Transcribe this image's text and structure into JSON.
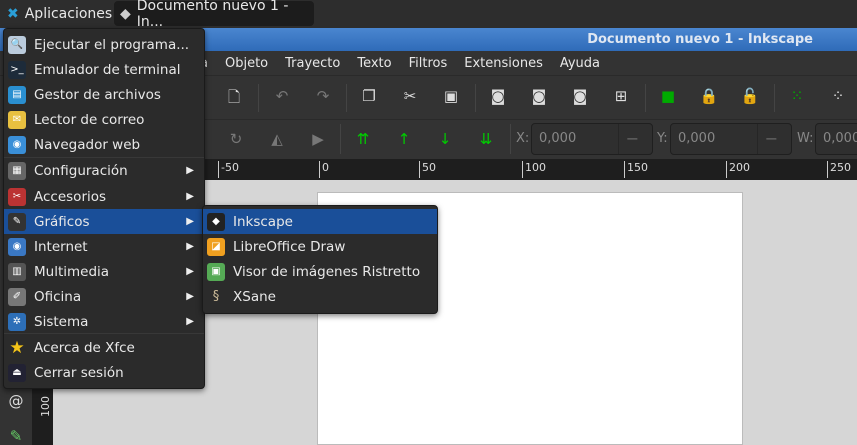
{
  "panel": {
    "apps_label": "Aplicaciones",
    "task_label": "Documento nuevo 1 - In..."
  },
  "window": {
    "title": "Documento nuevo 1 - Inkscape"
  },
  "menubar": [
    "a",
    "Objeto",
    "Trayecto",
    "Texto",
    "Filtros",
    "Extensiones",
    "Ayuda"
  ],
  "toolbar": {
    "x_label": "X:",
    "x_value": "0,000",
    "y_label": "Y:",
    "y_value": "0,000",
    "w_label": "W:",
    "w_value": "0,000",
    "minus": "−",
    "plus": "+"
  },
  "ruler": {
    "h_ticks": [
      "-50",
      "0",
      "50",
      "100",
      "150",
      "200",
      "250"
    ],
    "v_tick": "100"
  },
  "app_menu": {
    "items": [
      {
        "label": "Ejecutar el programa...",
        "icon": "search-icon"
      },
      {
        "label": "Emulador de terminal",
        "icon": "terminal-icon"
      },
      {
        "label": "Gestor de archivos",
        "icon": "file-manager-icon"
      },
      {
        "label": "Lector de correo",
        "icon": "mail-icon"
      },
      {
        "label": "Navegador web",
        "icon": "web-browser-icon"
      },
      {
        "label": "Configuración",
        "icon": "settings-icon",
        "submenu": true
      },
      {
        "label": "Accesorios",
        "icon": "accessories-icon",
        "submenu": true
      },
      {
        "label": "Gráficos",
        "icon": "graphics-icon",
        "submenu": true,
        "highlighted": true
      },
      {
        "label": "Internet",
        "icon": "internet-icon",
        "submenu": true
      },
      {
        "label": "Multimedia",
        "icon": "multimedia-icon",
        "submenu": true
      },
      {
        "label": "Oficina",
        "icon": "office-icon",
        "submenu": true
      },
      {
        "label": "Sistema",
        "icon": "system-icon",
        "submenu": true
      },
      {
        "label": "Acerca de Xfce",
        "icon": "star-icon"
      },
      {
        "label": "Cerrar sesión",
        "icon": "logout-icon"
      }
    ]
  },
  "graphics_submenu": {
    "items": [
      {
        "label": "Inkscape",
        "icon": "inkscape-icon",
        "highlighted": true
      },
      {
        "label": "LibreOffice Draw",
        "icon": "libreoffice-draw-icon"
      },
      {
        "label": "Visor de imágenes Ristretto",
        "icon": "image-viewer-icon"
      },
      {
        "label": "XSane",
        "icon": "scanner-icon"
      }
    ]
  },
  "colors": {
    "highlight": "#1a4f99",
    "titlebar": "#3a78c4"
  }
}
